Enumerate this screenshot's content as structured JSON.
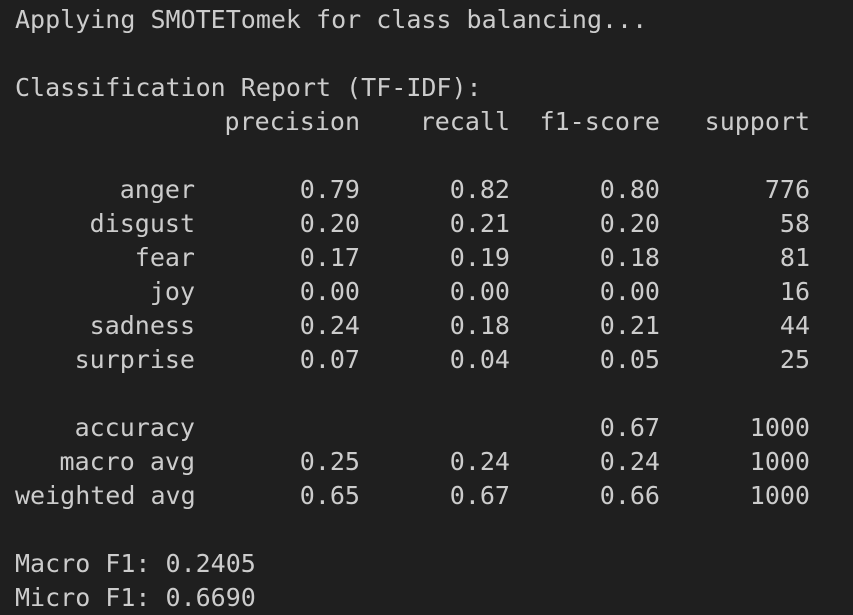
{
  "log": {
    "smote_line": "Applying SMOTETomek for class balancing..."
  },
  "report": {
    "title": "Classification Report (TF-IDF):",
    "headers": {
      "precision": "precision",
      "recall": "recall",
      "f1": "f1-score",
      "support": "support"
    },
    "classes": [
      {
        "label": "anger",
        "precision": "0.79",
        "recall": "0.82",
        "f1": "0.80",
        "support": "776"
      },
      {
        "label": "disgust",
        "precision": "0.20",
        "recall": "0.21",
        "f1": "0.20",
        "support": "58"
      },
      {
        "label": "fear",
        "precision": "0.17",
        "recall": "0.19",
        "f1": "0.18",
        "support": "81"
      },
      {
        "label": "joy",
        "precision": "0.00",
        "recall": "0.00",
        "f1": "0.00",
        "support": "16"
      },
      {
        "label": "sadness",
        "precision": "0.24",
        "recall": "0.18",
        "f1": "0.21",
        "support": "44"
      },
      {
        "label": "surprise",
        "precision": "0.07",
        "recall": "0.04",
        "f1": "0.05",
        "support": "25"
      }
    ],
    "summary": [
      {
        "label": "accuracy",
        "precision": "",
        "recall": "",
        "f1": "0.67",
        "support": "1000"
      },
      {
        "label": "macro avg",
        "precision": "0.25",
        "recall": "0.24",
        "f1": "0.24",
        "support": "1000"
      },
      {
        "label": "weighted avg",
        "precision": "0.65",
        "recall": "0.67",
        "f1": "0.66",
        "support": "1000"
      }
    ]
  },
  "metrics": {
    "macro_f1": "Macro F1: 0.2405",
    "micro_f1": "Micro F1: 0.6690"
  }
}
